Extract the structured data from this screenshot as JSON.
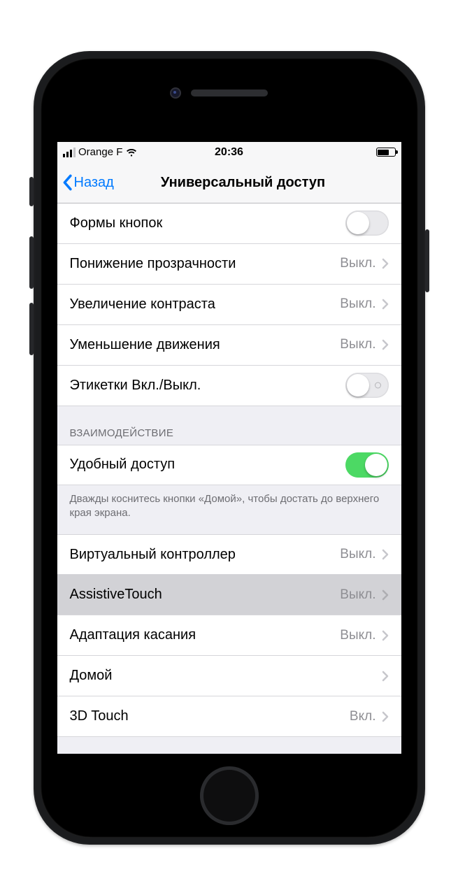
{
  "statusbar": {
    "carrier": "Orange F",
    "time": "20:36"
  },
  "nav": {
    "back": "Назад",
    "title": "Универсальный доступ"
  },
  "vision": {
    "items": [
      {
        "label": "Формы кнопок",
        "type": "toggle",
        "on": false
      },
      {
        "label": "Понижение прозрачности",
        "type": "link",
        "value": "Выкл."
      },
      {
        "label": "Увеличение контраста",
        "type": "link",
        "value": "Выкл."
      },
      {
        "label": "Уменьшение движения",
        "type": "link",
        "value": "Выкл."
      },
      {
        "label": "Этикетки Вкл./Выкл.",
        "type": "toggle",
        "on": false,
        "labeled": true
      }
    ]
  },
  "interaction": {
    "header": "ВЗАИМОДЕЙСТВИЕ",
    "reachability": {
      "label": "Удобный доступ",
      "on": true
    },
    "footer": "Дважды коснитесь кнопки «Домой», чтобы достать до верхнего края экрана.",
    "items": [
      {
        "label": "Виртуальный контроллер",
        "value": "Выкл."
      },
      {
        "label": "AssistiveTouch",
        "value": "Выкл.",
        "highlighted": true
      },
      {
        "label": "Адаптация касания",
        "value": "Выкл."
      },
      {
        "label": "Домой",
        "value": ""
      },
      {
        "label": "3D Touch",
        "value": "Вкл."
      }
    ]
  }
}
